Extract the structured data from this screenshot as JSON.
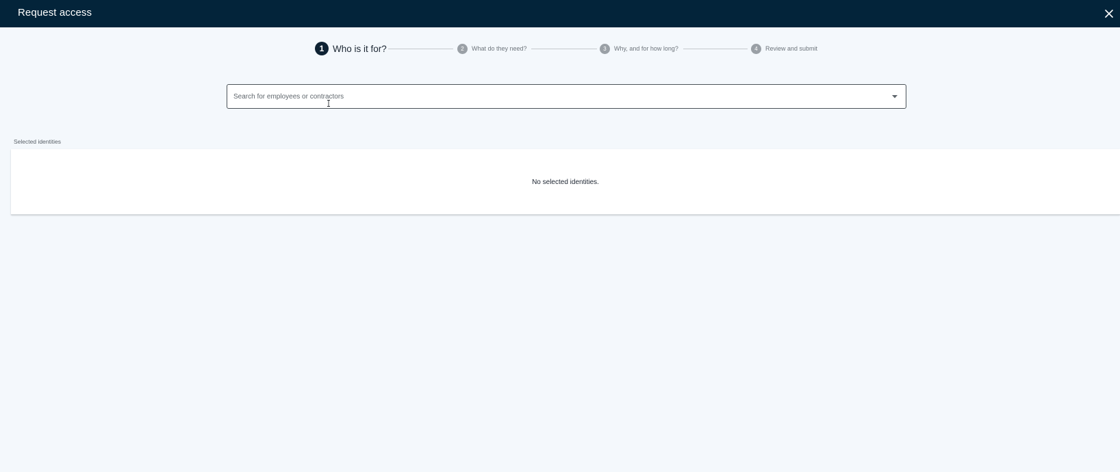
{
  "header": {
    "title": "Request access",
    "close_icon": "close-icon"
  },
  "stepper": {
    "steps": [
      {
        "number": "1",
        "label": "Who is it for?",
        "state": "active"
      },
      {
        "number": "2",
        "label": "What do they need?",
        "state": "inactive"
      },
      {
        "number": "3",
        "label": "Why, and for how long?",
        "state": "inactive"
      },
      {
        "number": "4",
        "label": "Review and submit",
        "state": "inactive"
      }
    ]
  },
  "search": {
    "placeholder": "Search for employees or contractors",
    "value": "",
    "dropdown_icon": "caret-down-icon"
  },
  "selected_identities": {
    "label": "Selected identities",
    "empty_message": "No selected identities."
  },
  "colors": {
    "header_bg": "#03243a",
    "page_bg": "#f4f8fc",
    "active_step": "#0e2233",
    "inactive_step": "#9aa0a6"
  }
}
